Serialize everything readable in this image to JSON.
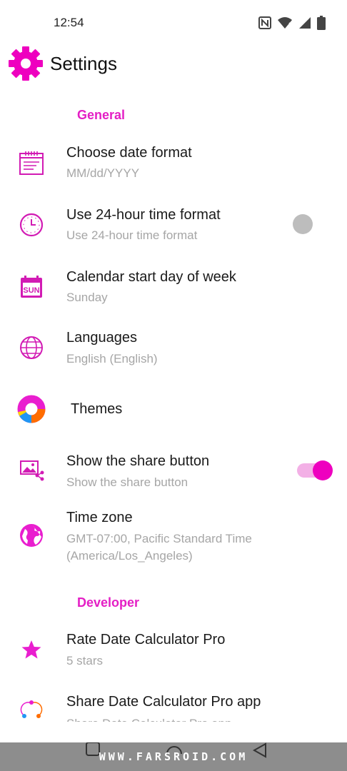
{
  "status_bar": {
    "time": "12:54",
    "icons": [
      "nfc-icon",
      "wifi-icon",
      "signal-icon",
      "battery-icon"
    ]
  },
  "header": {
    "title": "Settings",
    "icon": "gear-icon"
  },
  "colors": {
    "accent": "#e41fc5",
    "toggle_on": "#ee00bf",
    "subtitle": "#a6a6a6"
  },
  "sections": {
    "general": "General",
    "developer": "Developer"
  },
  "items": {
    "date_format": {
      "title": "Choose date format",
      "subtitle": "MM/dd/YYYY",
      "icon": "calendar-list-icon"
    },
    "time_format": {
      "title": "Use 24-hour time format",
      "subtitle": "Use 24-hour time format",
      "icon": "clock-icon",
      "toggle": false
    },
    "start_day": {
      "title": "Calendar start day of week",
      "subtitle": "Sunday",
      "icon": "calendar-sun-icon",
      "badge": "SUN"
    },
    "languages": {
      "title": "Languages",
      "subtitle": "English (English)",
      "icon": "globe-icon"
    },
    "themes": {
      "title": "Themes",
      "icon": "color-ring-icon"
    },
    "share_button": {
      "title": "Show the share button",
      "subtitle": "Show the share button",
      "icon": "image-share-icon",
      "toggle": true
    },
    "time_zone": {
      "title": "Time zone",
      "subtitle_line1": "GMT-07:00, Pacific Standard Time",
      "subtitle_line2": "(America/Los_Angeles)",
      "icon": "earth-icon"
    },
    "rate": {
      "title": "Rate Date Calculator Pro",
      "subtitle": "5 stars",
      "icon": "star-icon"
    },
    "share_app": {
      "title": "Share Date Calculator Pro app",
      "subtitle": "Share Date Calculator Pro app",
      "icon": "share-dots-icon"
    }
  },
  "nav_bar": {
    "watermark": "WWW.FARSROID.COM",
    "buttons": [
      "recents-icon",
      "home-icon",
      "back-icon"
    ]
  }
}
